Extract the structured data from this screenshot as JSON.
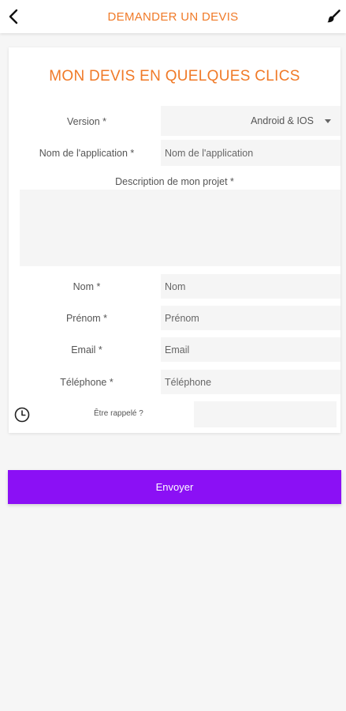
{
  "colors": {
    "accent": "#f07a28",
    "button": "#8b10f5",
    "background": "#f6f6f6",
    "field_bg": "#f5f5f5"
  },
  "header": {
    "title": "DEMANDER UN DEVIS",
    "back_icon": "chevron-left-icon",
    "action_icon": "paint-brush-icon"
  },
  "form": {
    "title": "MON DEVIS EN QUELQUES CLICS",
    "version": {
      "label": "Version *",
      "value": "Android & IOS"
    },
    "app_name": {
      "label": "Nom de l'application *",
      "placeholder": "Nom de l'application"
    },
    "description": {
      "label": "Description de mon projet *",
      "placeholder": ""
    },
    "last_name": {
      "label": "Nom *",
      "placeholder": "Nom"
    },
    "first_name": {
      "label": "Prénom *",
      "placeholder": "Prénom"
    },
    "email": {
      "label": "Email *",
      "placeholder": "Email"
    },
    "phone": {
      "label": "Téléphone *",
      "placeholder": "Téléphone"
    },
    "callback": {
      "label": "Être rappelé ?",
      "value": "",
      "icon": "clock-icon"
    }
  },
  "submit_label": "Envoyer"
}
